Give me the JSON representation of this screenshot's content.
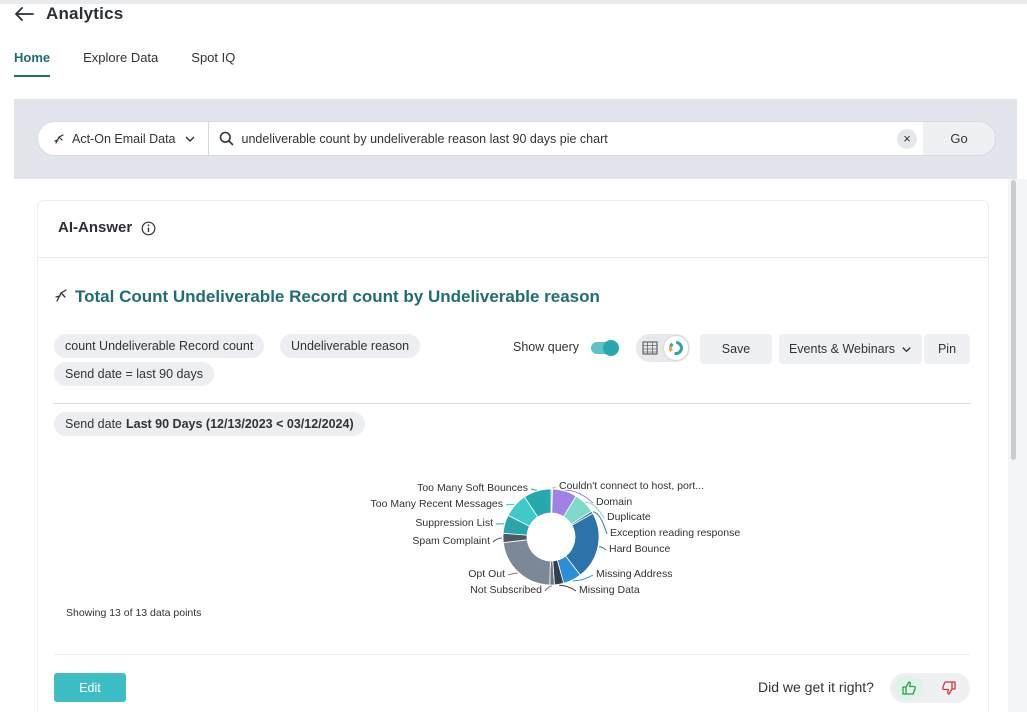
{
  "app": {
    "title": "Analytics"
  },
  "tabs": [
    {
      "label": "Home",
      "active": true
    },
    {
      "label": "Explore Data",
      "active": false
    },
    {
      "label": "Spot IQ",
      "active": false
    }
  ],
  "search": {
    "source": "Act-On Email Data",
    "query": "undeliverable count by undeliverable reason last 90 days pie chart",
    "go_label": "Go"
  },
  "answer": {
    "section_title": "AI-Answer",
    "title": "Total Count Undeliverable Record count by Undeliverable reason",
    "chips": [
      "count Undeliverable Record count",
      "Undeliverable reason",
      "Send date = last 90 days"
    ],
    "filter_chip": {
      "label": "Send date",
      "value": "Last 90 Days (12/13/2023 < 03/12/2024)"
    },
    "show_query_label": "Show query",
    "show_query_on": true,
    "save_label": "Save",
    "liveboard_label": "Events & Webinars",
    "pin_label": "Pin",
    "points_text": "Showing 13 of 13 data points",
    "edit_label": "Edit",
    "feedback_label": "Did we get it right?"
  },
  "chart_data": {
    "type": "pie",
    "donut": true,
    "labels": [
      "Couldn't connect to host, port...",
      "Domain",
      "Duplicate",
      "Exception reading response",
      "Hard Bounce",
      "Missing Address",
      "Missing Data",
      "Not Subscribed",
      "Opt Out",
      "Spam Complaint",
      "Suppression List",
      "Too Many Recent Messages",
      "Too Many Soft Bounces"
    ],
    "values": [
      0.5,
      8,
      7,
      0.8,
      22,
      6,
      3,
      1.5,
      22,
      3,
      6,
      8,
      9
    ],
    "colors": [
      "#7ed3d6",
      "#a082e6",
      "#7fdac9",
      "#2f7ea8",
      "#2b73a8",
      "#2a8fd6",
      "#333e4f",
      "#6c7886",
      "#7c8896",
      "#4d5866",
      "#2aa5a8",
      "#3fc9c9",
      "#27a8ad"
    ]
  }
}
